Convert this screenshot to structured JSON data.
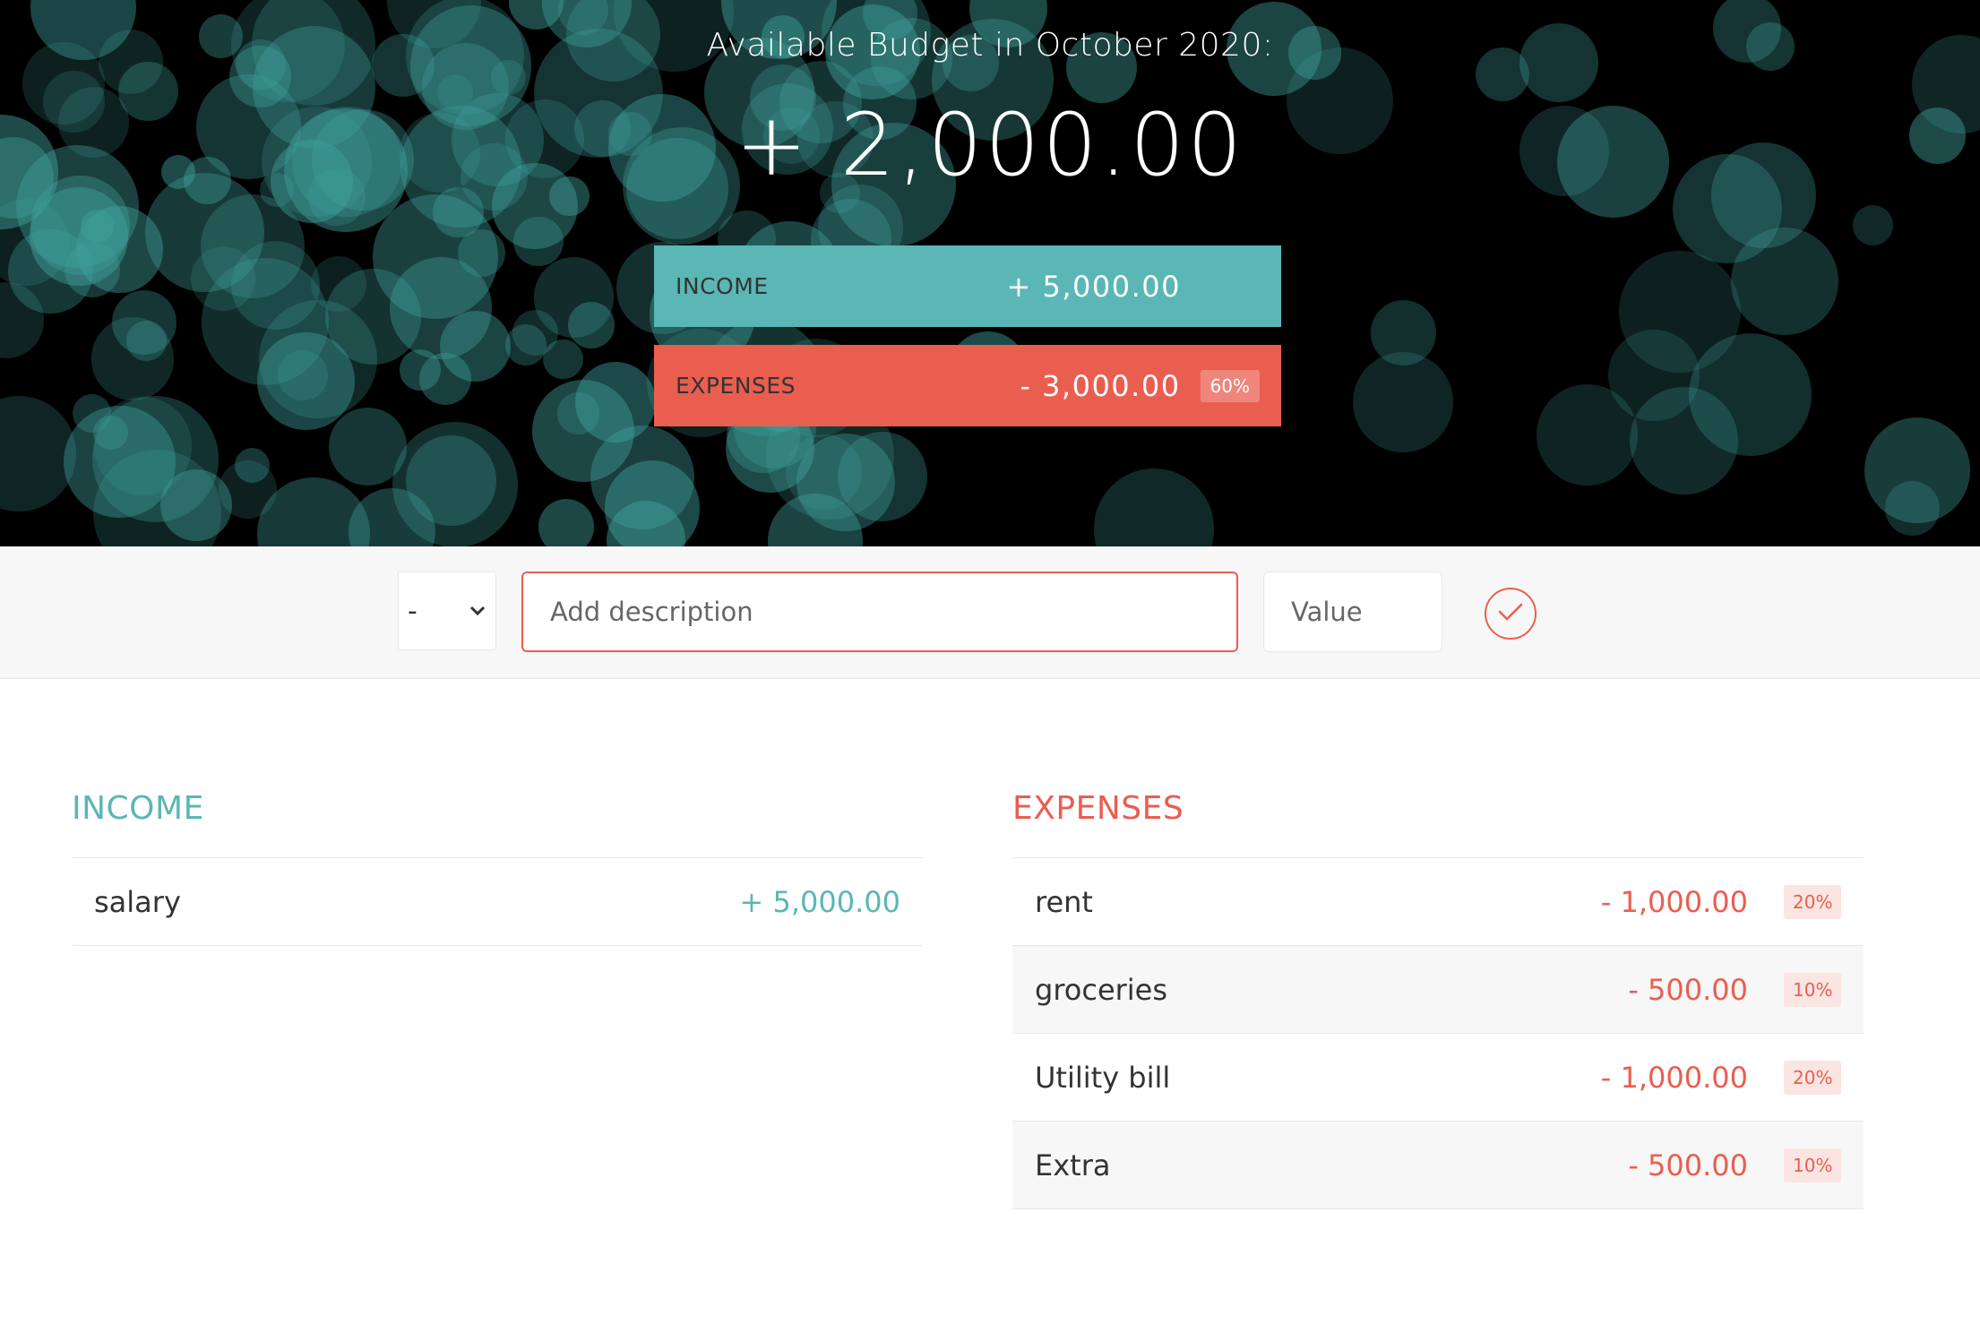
{
  "header": {
    "title": "Available Budget in October 2020:",
    "budget": "+ 2,000.00",
    "income_summary": {
      "label": "INCOME",
      "value": "+ 5,000.00"
    },
    "expenses_summary": {
      "label": "EXPENSES",
      "value": "- 3,000.00",
      "percentage": "60%"
    }
  },
  "add_form": {
    "type_selected": "-",
    "description_placeholder": "Add description",
    "value_placeholder": "Value",
    "submit_icon": "check-circle-icon"
  },
  "income": {
    "title": "INCOME",
    "items": [
      {
        "description": "salary",
        "value": "+ 5,000.00"
      }
    ]
  },
  "expenses": {
    "title": "EXPENSES",
    "items": [
      {
        "description": "rent",
        "value": "- 1,000.00",
        "percentage": "20%"
      },
      {
        "description": "groceries",
        "value": "- 500.00",
        "percentage": "10%"
      },
      {
        "description": "Utility bill",
        "value": "- 1,000.00",
        "percentage": "20%"
      },
      {
        "description": "Extra",
        "value": "- 500.00",
        "percentage": "10%"
      }
    ]
  },
  "colors": {
    "income": "#5ab7b5",
    "expenses": "#ea5e50",
    "header_bg": "#000000",
    "bokeh": "#40a29e"
  }
}
